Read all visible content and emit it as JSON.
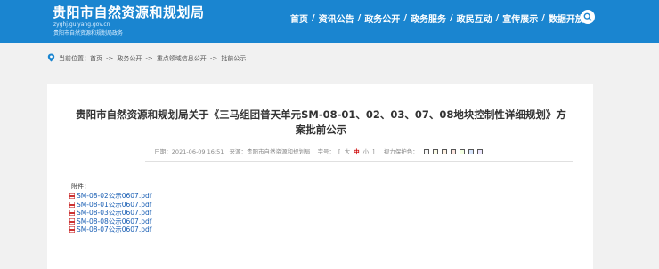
{
  "header": {
    "site_title": "贵阳市自然资源和规划局",
    "domain": "zyghj.guiyang.gov.cn",
    "subtitle": "贵阳市自然资源和规划局政务",
    "nav": [
      "首页",
      "资讯公告",
      "政务公开",
      "政务服务",
      "政民互动",
      "宣传展示",
      "数据开放"
    ],
    "separator": "/",
    "search_icon": "search-icon",
    "colors": {
      "header_bg": "#1a85d0"
    }
  },
  "breadcrumb": {
    "location_icon": "location-pin-icon",
    "prefix": "当前位置：",
    "items": [
      "首页",
      "政务公开",
      "重点领域信息公开",
      "批前公示"
    ],
    "separator": "->"
  },
  "article": {
    "title": "贵阳市自然资源和规划局关于《三马组团普天单元SM-08-01、02、03、07、08地块控制性详细规划》方案批前公示",
    "date": "日期：2021-06-09 16:51",
    "source": "来源：贵阳市自然资源和规划局",
    "font_size_label": "字号：",
    "font_sizes": [
      "大",
      "中",
      "小"
    ],
    "font_bracket_open": "[",
    "font_bracket_close": "]",
    "protect_label": "视力保护色：",
    "protect_colors": [
      "#f7f7f7",
      "#fafbe6",
      "#fff2e2",
      "#fde6e0",
      "#f3ffe1",
      "#dae7ff",
      "#eee8ff"
    ],
    "attachment_label": "附件：",
    "attachments": [
      "SM-08-02公示0607.pdf",
      "SM-08-01公示0607.pdf",
      "SM-08-03公示0607.pdf",
      "SM-08-08公示0607.pdf",
      "SM-08-07公示0607.pdf"
    ],
    "attachment_icon": "pdf-icon"
  }
}
